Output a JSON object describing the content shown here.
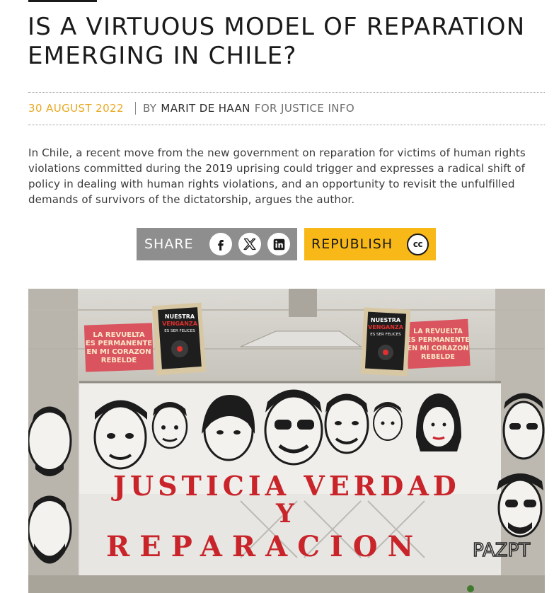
{
  "article": {
    "title": "IS A VIRTUOUS MODEL OF REPARATION EMERGING IN CHILE?",
    "date": "30 AUGUST 2022",
    "by": "BY",
    "author": "MARIT DE HAAN",
    "publication": "FOR JUSTICE INFO",
    "lead": "In Chile, a recent move from the new government on reparation for victims of human rights violations committed during the 2019 uprising could trigger and expresses a radical shift of policy in dealing with human rights violations, and an opportunity to revisit the unfulfilled demands of survivors of the dictatorship, argues the author."
  },
  "share": {
    "label": "SHARE",
    "icons": [
      "facebook-icon",
      "x-icon",
      "linkedin-icon"
    ]
  },
  "republish": {
    "label": "REPUBLISH",
    "badge": "cc"
  },
  "photo": {
    "posters": {
      "left_pink": [
        "LA REVUELTA",
        "ES PERMANENTE",
        "EN MI CORAZON",
        "REBELDE"
      ],
      "right_pink": [
        "LA REVUELTA",
        "ES PERMANENTE",
        "EN MI CORAZON",
        "REBELDE"
      ],
      "left_dark": [
        "NUESTRA",
        "VENGANZA",
        "ES SER FELICES"
      ],
      "right_dark": [
        "NUESTRA",
        "VENGANZA",
        "ES SER FELICES"
      ]
    },
    "wall_text": {
      "line1": "JUSTICIA VERDAD",
      "line2": "Y",
      "line3": "REPARACION",
      "tag": "PAZPT"
    }
  },
  "colors": {
    "date": "#e8a820",
    "share_bg": "#8e8e8e",
    "republish_bg": "#f8b817",
    "stencil_red": "#c8242a"
  }
}
